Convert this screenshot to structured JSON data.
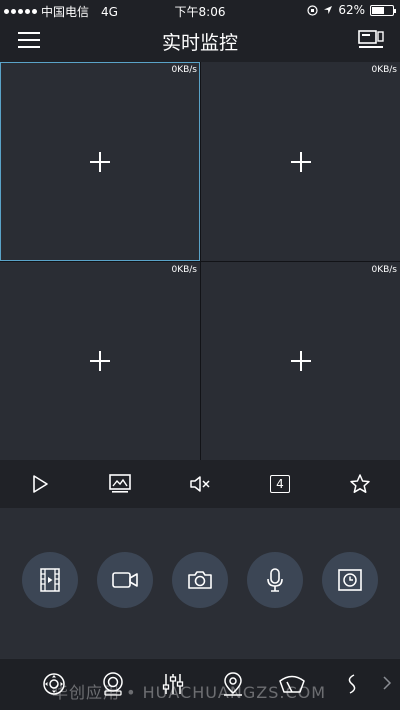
{
  "status_bar": {
    "carrier": "中国电信",
    "network": "4G",
    "time": "下午8:06",
    "battery": "62%",
    "battery_level": 0.62
  },
  "nav": {
    "title": "实时监控",
    "menu_icon": "hamburger-menu-icon",
    "device_icon": "device-switch-icon"
  },
  "grid": {
    "cells": [
      {
        "rate": "0KB/s",
        "selected": true
      },
      {
        "rate": "0KB/s",
        "selected": false
      },
      {
        "rate": "0KB/s",
        "selected": false
      },
      {
        "rate": "0KB/s",
        "selected": false
      }
    ]
  },
  "toolbar": {
    "items": [
      {
        "icon": "play-icon"
      },
      {
        "icon": "image-icon"
      },
      {
        "icon": "mute-icon"
      },
      {
        "icon": "split-screen-icon",
        "label": "4"
      },
      {
        "icon": "star-icon"
      }
    ]
  },
  "controls": {
    "items": [
      {
        "icon": "film-icon"
      },
      {
        "icon": "video-record-icon"
      },
      {
        "icon": "camera-icon"
      },
      {
        "icon": "microphone-icon"
      },
      {
        "icon": "playback-icon"
      }
    ]
  },
  "bottom_bar": {
    "items": [
      {
        "icon": "ptz-icon"
      },
      {
        "icon": "lens-icon"
      },
      {
        "icon": "adjust-icon"
      },
      {
        "icon": "location-icon"
      },
      {
        "icon": "wiper-icon"
      },
      {
        "icon": "more-icon"
      }
    ],
    "watermark": "华创应用 • HUACHUANGZS.COM"
  },
  "colors": {
    "background": "#1f2126",
    "cell": "#2a2d34",
    "selected_border": "#5aa3c8",
    "circle_button": "#3c4655"
  }
}
